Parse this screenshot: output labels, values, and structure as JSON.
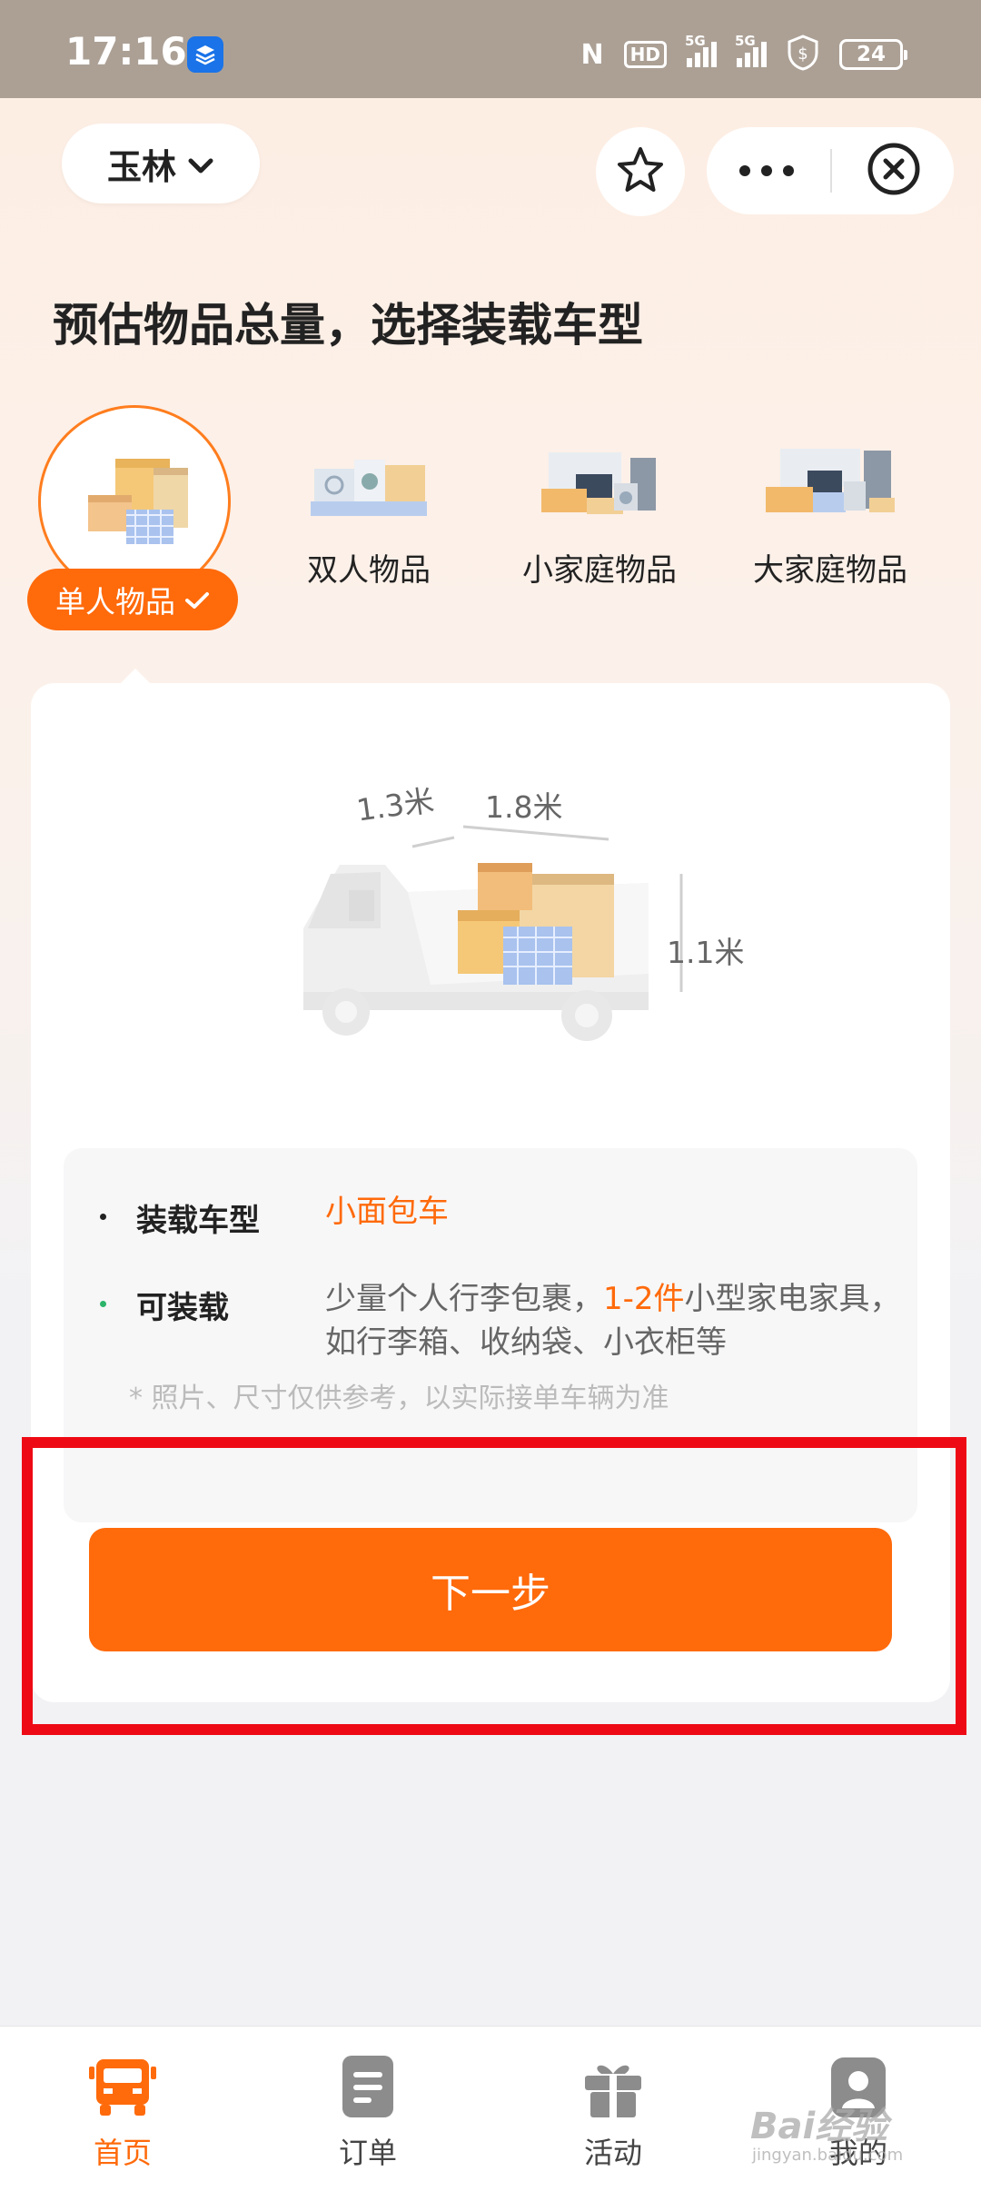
{
  "status_bar": {
    "time": "17:16",
    "nfc": "N",
    "hd": "HD",
    "signal_1": "5G",
    "signal_2": "5G",
    "battery": "24"
  },
  "header": {
    "city": "玉林",
    "favorite_icon": "star-icon",
    "more_icon": "more-dots-icon",
    "close_icon": "close-circle-icon"
  },
  "page_title": "预估物品总量，选择装载车型",
  "categories": [
    {
      "label": "单人物品",
      "selected": true
    },
    {
      "label": "双人物品",
      "selected": false
    },
    {
      "label": "小家庭物品",
      "selected": false
    },
    {
      "label": "大家庭物品",
      "selected": false
    }
  ],
  "van": {
    "width": "1.3米",
    "length": "1.8米",
    "height": "1.1米"
  },
  "info": {
    "vehicle_label": "装载车型",
    "vehicle_value": "小面包车",
    "capacity_label": "可装载",
    "capacity_pre": "少量个人行李包裹，",
    "capacity_highlight": "1-2件",
    "capacity_post": "小型家电家具，",
    "capacity_line2": "如行李箱、收纳袋、小衣柜等",
    "note": "* 照片、尺寸仅供参考，以实际接单车辆为准"
  },
  "next_button": "下一步",
  "tabbar": [
    {
      "label": "首页",
      "icon": "truck-icon",
      "active": true
    },
    {
      "label": "订单",
      "icon": "document-icon",
      "active": false
    },
    {
      "label": "活动",
      "icon": "gift-icon",
      "active": false
    },
    {
      "label": "我的",
      "icon": "profile-icon",
      "active": false
    }
  ],
  "watermark": "Bai经验",
  "watermark_sub": "jingyan.baidu.com",
  "colors": {
    "accent": "#ff6a0b",
    "highlight_frame": "#ee0a14"
  }
}
